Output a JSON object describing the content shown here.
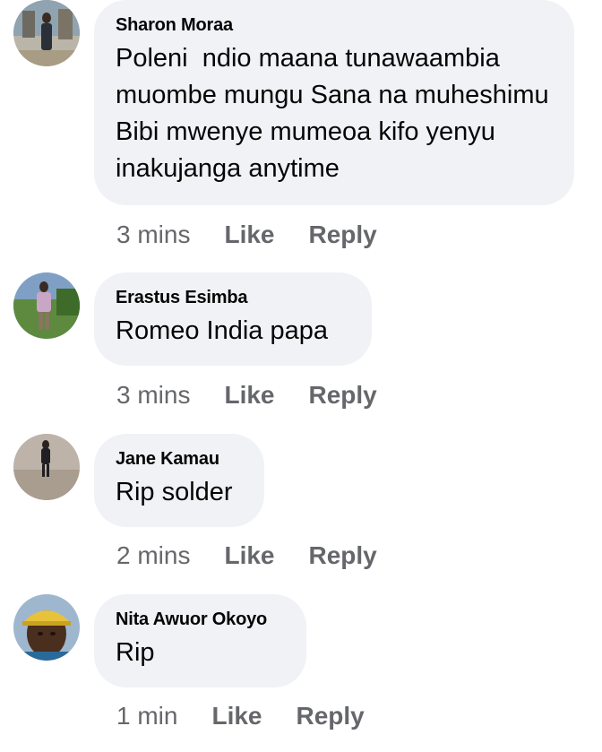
{
  "comments": [
    {
      "author": "Sharon Moraa",
      "text": "Poleni  ndio maana tunawaambia muombe mungu Sana na muheshimu Bibi mwenye mumeoa kifo yenyu inakujanga anytime",
      "time": "3 mins",
      "like": "Like",
      "reply": "Reply"
    },
    {
      "author": "Erastus Esimba",
      "text": "Romeo India papa",
      "time": "3 mins",
      "like": "Like",
      "reply": "Reply"
    },
    {
      "author": "Jane Kamau",
      "text": "Rip solder",
      "time": "2 mins",
      "like": "Like",
      "reply": "Reply"
    },
    {
      "author": "Nita Awuor Okoyo",
      "text": "Rip",
      "time": "1 min",
      "like": "Like",
      "reply": "Reply"
    }
  ],
  "colors": {
    "bubble": "#f0f2f5",
    "text": "#050505",
    "meta": "#65676b"
  }
}
